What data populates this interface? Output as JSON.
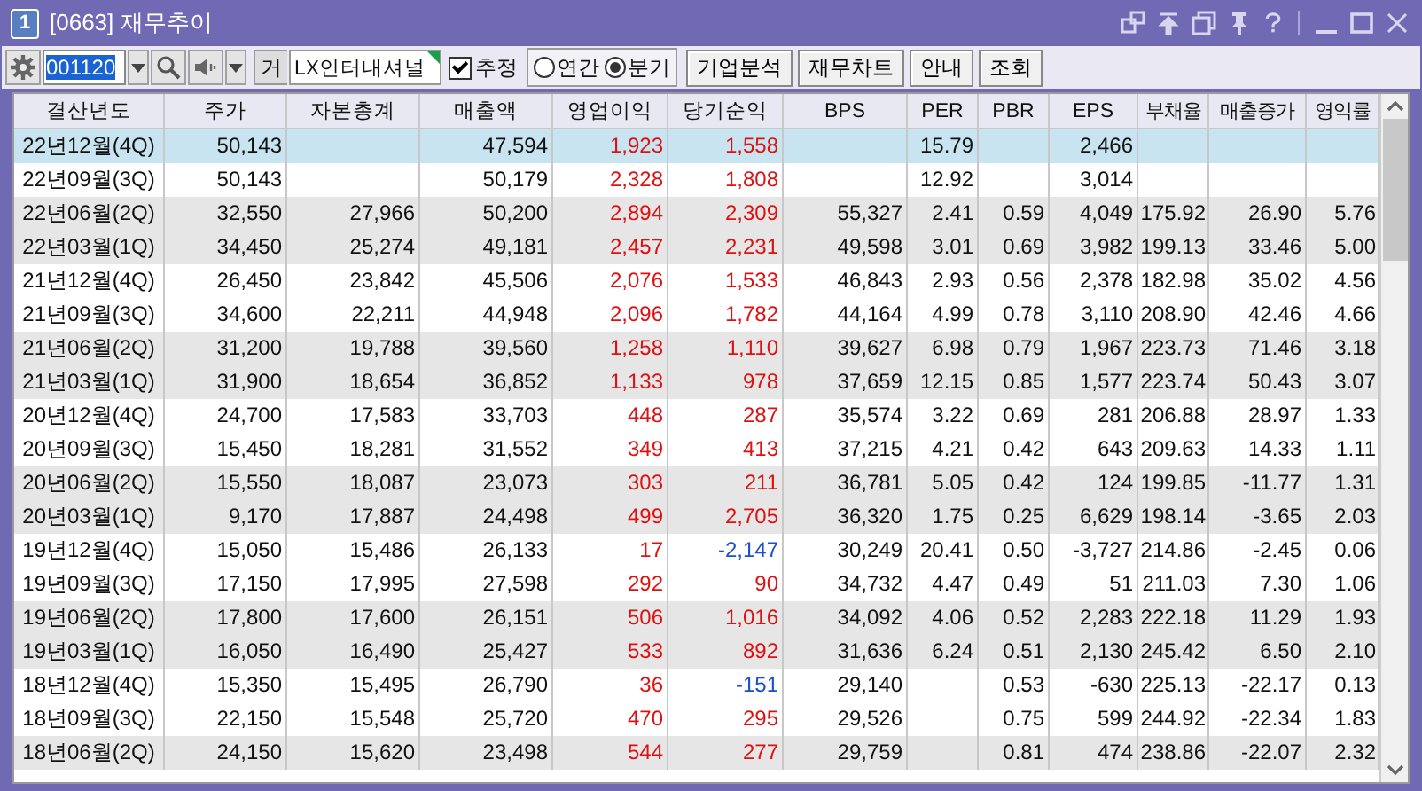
{
  "window": {
    "badge": "1",
    "title": "[0663] 재무추이"
  },
  "toolbar": {
    "code": "001120",
    "prefix": "거",
    "company": "LX인터내셔널",
    "estimate": {
      "label": "추정",
      "checked": true
    },
    "period": [
      {
        "label": "연간",
        "selected": false
      },
      {
        "label": "분기",
        "selected": true
      }
    ],
    "buttons": [
      "기업분석",
      "재무차트",
      "안내",
      "조회"
    ]
  },
  "table": {
    "columns": [
      {
        "label": "결산년도",
        "kind": "center"
      },
      {
        "label": "주가",
        "kind": "num"
      },
      {
        "label": "자본총계",
        "kind": "num"
      },
      {
        "label": "매출액",
        "kind": "num"
      },
      {
        "label": "영업이익",
        "kind": "signed"
      },
      {
        "label": "당기순익",
        "kind": "signed"
      },
      {
        "label": "BPS",
        "kind": "num"
      },
      {
        "label": "PER",
        "kind": "num"
      },
      {
        "label": "PBR",
        "kind": "num"
      },
      {
        "label": "EPS",
        "kind": "num"
      },
      {
        "label": "부채율",
        "kind": "num"
      },
      {
        "label": "매출증가",
        "kind": "num"
      },
      {
        "label": "영익률",
        "kind": "num"
      }
    ],
    "rows": [
      {
        "selected": true,
        "shaded": false,
        "cells": [
          "22년12월(4Q)",
          "50,143",
          "",
          "47,594",
          "1,923",
          "1,558",
          "",
          "15.79",
          "",
          "2,466",
          "",
          "",
          ""
        ]
      },
      {
        "selected": false,
        "shaded": false,
        "cells": [
          "22년09월(3Q)",
          "50,143",
          "",
          "50,179",
          "2,328",
          "1,808",
          "",
          "12.92",
          "",
          "3,014",
          "",
          "",
          ""
        ]
      },
      {
        "selected": false,
        "shaded": true,
        "cells": [
          "22년06월(2Q)",
          "32,550",
          "27,966",
          "50,200",
          "2,894",
          "2,309",
          "55,327",
          "2.41",
          "0.59",
          "4,049",
          "175.92",
          "26.90",
          "5.76"
        ]
      },
      {
        "selected": false,
        "shaded": true,
        "cells": [
          "22년03월(1Q)",
          "34,450",
          "25,274",
          "49,181",
          "2,457",
          "2,231",
          "49,598",
          "3.01",
          "0.69",
          "3,982",
          "199.13",
          "33.46",
          "5.00"
        ]
      },
      {
        "selected": false,
        "shaded": false,
        "cells": [
          "21년12월(4Q)",
          "26,450",
          "23,842",
          "45,506",
          "2,076",
          "1,533",
          "46,843",
          "2.93",
          "0.56",
          "2,378",
          "182.98",
          "35.02",
          "4.56"
        ]
      },
      {
        "selected": false,
        "shaded": false,
        "cells": [
          "21년09월(3Q)",
          "34,600",
          "22,211",
          "44,948",
          "2,096",
          "1,782",
          "44,164",
          "4.99",
          "0.78",
          "3,110",
          "208.90",
          "42.46",
          "4.66"
        ]
      },
      {
        "selected": false,
        "shaded": true,
        "cells": [
          "21년06월(2Q)",
          "31,200",
          "19,788",
          "39,560",
          "1,258",
          "1,110",
          "39,627",
          "6.98",
          "0.79",
          "1,967",
          "223.73",
          "71.46",
          "3.18"
        ]
      },
      {
        "selected": false,
        "shaded": true,
        "cells": [
          "21년03월(1Q)",
          "31,900",
          "18,654",
          "36,852",
          "1,133",
          "978",
          "37,659",
          "12.15",
          "0.85",
          "1,577",
          "223.74",
          "50.43",
          "3.07"
        ]
      },
      {
        "selected": false,
        "shaded": false,
        "cells": [
          "20년12월(4Q)",
          "24,700",
          "17,583",
          "33,703",
          "448",
          "287",
          "35,574",
          "3.22",
          "0.69",
          "281",
          "206.88",
          "28.97",
          "1.33"
        ]
      },
      {
        "selected": false,
        "shaded": false,
        "cells": [
          "20년09월(3Q)",
          "15,450",
          "18,281",
          "31,552",
          "349",
          "413",
          "37,215",
          "4.21",
          "0.42",
          "643",
          "209.63",
          "14.33",
          "1.11"
        ]
      },
      {
        "selected": false,
        "shaded": true,
        "cells": [
          "20년06월(2Q)",
          "15,550",
          "18,087",
          "23,073",
          "303",
          "211",
          "36,781",
          "5.05",
          "0.42",
          "124",
          "199.85",
          "-11.77",
          "1.31"
        ]
      },
      {
        "selected": false,
        "shaded": true,
        "cells": [
          "20년03월(1Q)",
          "9,170",
          "17,887",
          "24,498",
          "499",
          "2,705",
          "36,320",
          "1.75",
          "0.25",
          "6,629",
          "198.14",
          "-3.65",
          "2.03"
        ]
      },
      {
        "selected": false,
        "shaded": false,
        "cells": [
          "19년12월(4Q)",
          "15,050",
          "15,486",
          "26,133",
          "17",
          "-2,147",
          "30,249",
          "20.41",
          "0.50",
          "-3,727",
          "214.86",
          "-2.45",
          "0.06"
        ]
      },
      {
        "selected": false,
        "shaded": false,
        "cells": [
          "19년09월(3Q)",
          "17,150",
          "17,995",
          "27,598",
          "292",
          "90",
          "34,732",
          "4.47",
          "0.49",
          "51",
          "211.03",
          "7.30",
          "1.06"
        ]
      },
      {
        "selected": false,
        "shaded": true,
        "cells": [
          "19년06월(2Q)",
          "17,800",
          "17,600",
          "26,151",
          "506",
          "1,016",
          "34,092",
          "4.06",
          "0.52",
          "2,283",
          "222.18",
          "11.29",
          "1.93"
        ]
      },
      {
        "selected": false,
        "shaded": true,
        "cells": [
          "19년03월(1Q)",
          "16,050",
          "16,490",
          "25,427",
          "533",
          "892",
          "31,636",
          "6.24",
          "0.51",
          "2,130",
          "245.42",
          "6.50",
          "2.10"
        ]
      },
      {
        "selected": false,
        "shaded": false,
        "cells": [
          "18년12월(4Q)",
          "15,350",
          "15,495",
          "26,790",
          "36",
          "-151",
          "29,140",
          "",
          "0.53",
          "-630",
          "225.13",
          "-22.17",
          "0.13"
        ]
      },
      {
        "selected": false,
        "shaded": false,
        "cells": [
          "18년09월(3Q)",
          "22,150",
          "15,548",
          "25,720",
          "470",
          "295",
          "29,526",
          "",
          "0.75",
          "599",
          "244.92",
          "-22.34",
          "1.83"
        ]
      },
      {
        "selected": false,
        "shaded": true,
        "cells": [
          "18년06월(2Q)",
          "24,150",
          "15,620",
          "23,498",
          "544",
          "277",
          "29,759",
          "",
          "0.81",
          "474",
          "238.86",
          "-22.07",
          "2.32"
        ]
      }
    ]
  }
}
